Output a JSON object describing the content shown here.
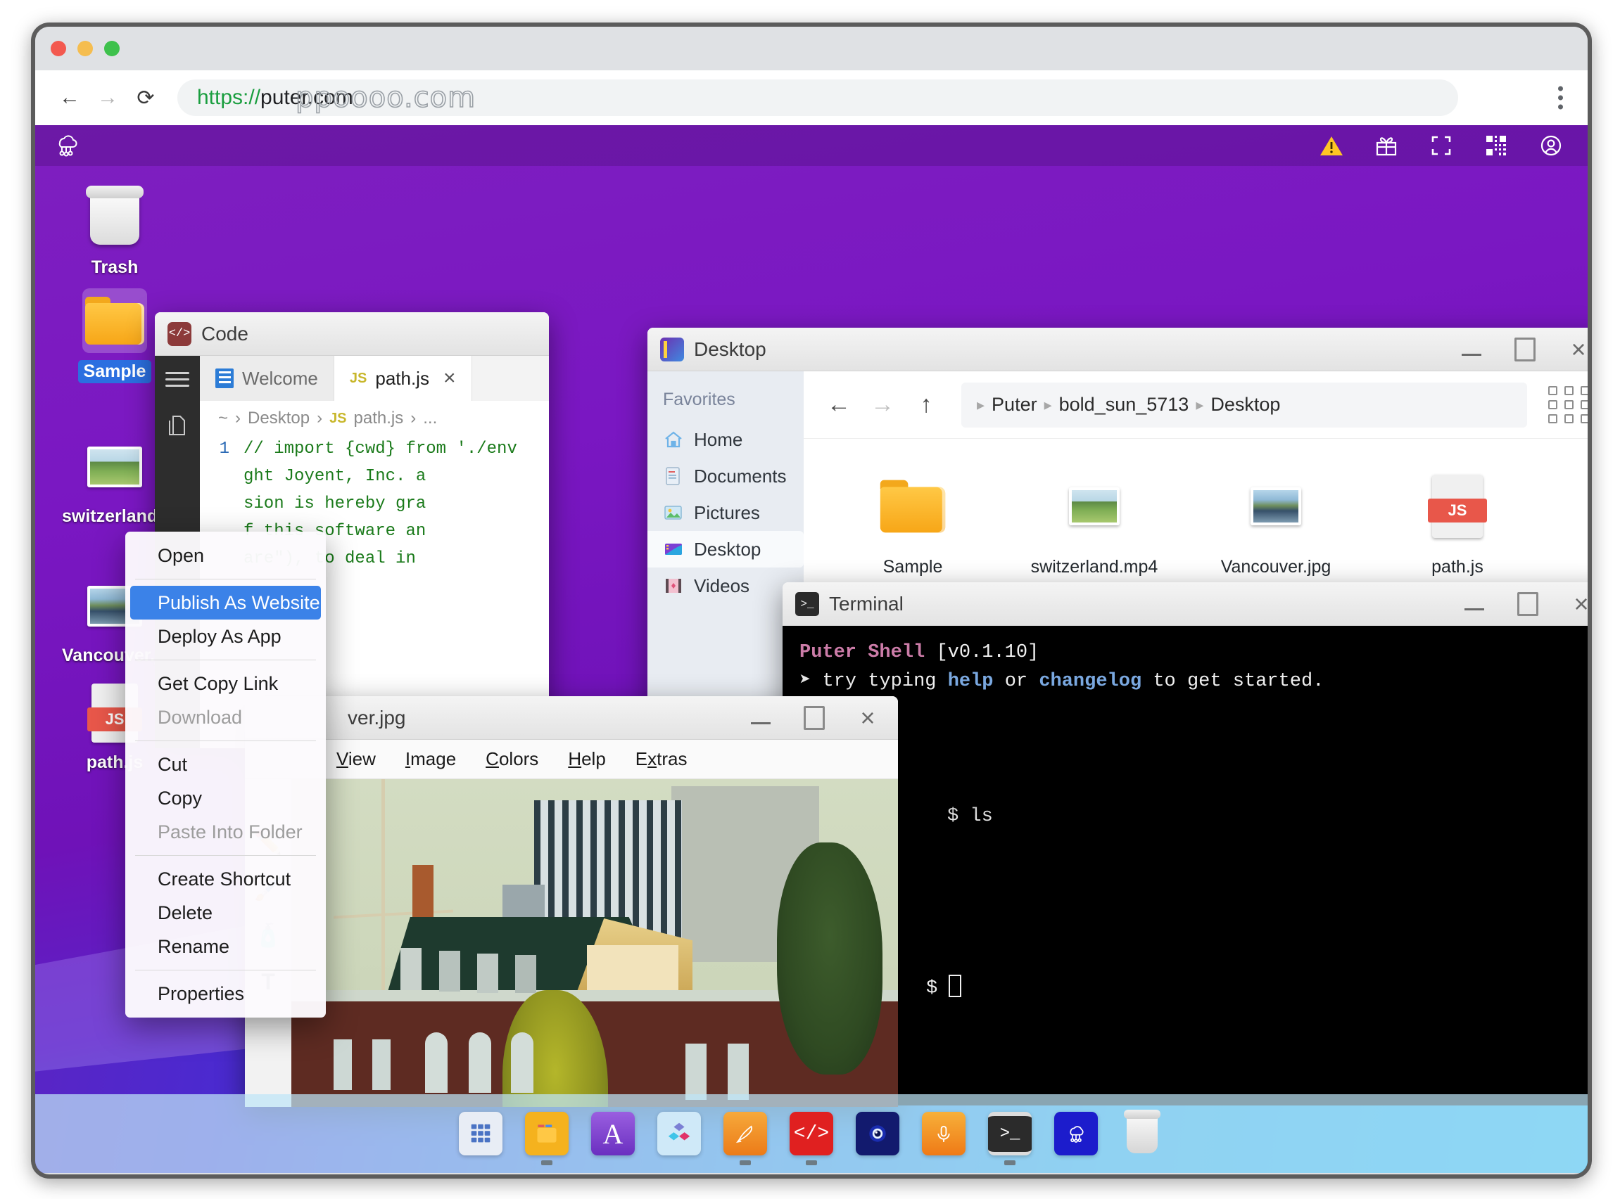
{
  "browser": {
    "url_scheme": "https://",
    "url_rest": "puter.com",
    "watermark": "ppoooo.com",
    "back_icon": "back-arrow-icon",
    "forward_icon": "forward-arrow-icon",
    "reload_icon": "reload-icon",
    "menu_icon": "kebab-menu-icon"
  },
  "topbar": {
    "logo": "puter-cloud-logo",
    "icons": [
      "warning-icon",
      "gift-icon",
      "fullscreen-icon",
      "qr-code-icon",
      "user-account-icon"
    ]
  },
  "desktop_icons": [
    {
      "label": "Trash",
      "icon": "trash-icon",
      "selected": false
    },
    {
      "label": "Sample",
      "icon": "folder-icon",
      "selected": true
    },
    {
      "label": "switzerland.mp4",
      "icon": "video-thumbnail",
      "selected": false
    },
    {
      "label": "Vancouver.jpg",
      "icon": "image-thumbnail",
      "selected": false
    },
    {
      "label": "path.js",
      "icon": "js-file-icon",
      "selected": false
    }
  ],
  "code_window": {
    "title": "Code",
    "tabs": [
      {
        "label": "Welcome",
        "icon": "welcome-icon",
        "active": false
      },
      {
        "label": "path.js",
        "icon": "js-icon",
        "active": true,
        "close": "×"
      }
    ],
    "breadcrumb": [
      "~",
      "Desktop",
      "path.js",
      "..."
    ],
    "js_tag": "JS",
    "lines": [
      {
        "n": "1",
        "text": "// import {cwd} from './env"
      },
      {
        "n": "",
        "text": ""
      },
      {
        "n": "",
        "text": "ght Joyent, Inc. a"
      },
      {
        "n": "",
        "text": ""
      },
      {
        "n": "",
        "text": "sion is hereby gra"
      },
      {
        "n": "",
        "text": "f this software an"
      },
      {
        "n": "",
        "text": "are\"), to deal in"
      }
    ]
  },
  "explorer_window": {
    "title": "Desktop",
    "sidebar_header": "Favorites",
    "sidebar_items": [
      {
        "label": "Home",
        "icon": "home-icon",
        "active": false
      },
      {
        "label": "Documents",
        "icon": "documents-icon",
        "active": false
      },
      {
        "label": "Pictures",
        "icon": "pictures-icon",
        "active": false
      },
      {
        "label": "Desktop",
        "icon": "desktop-icon",
        "active": true
      },
      {
        "label": "Videos",
        "icon": "videos-icon",
        "active": false
      }
    ],
    "breadcrumb": [
      "Puter",
      "bold_sun_5713",
      "Desktop"
    ],
    "nav": {
      "back": "back-arrow-icon",
      "forward": "forward-arrow-icon",
      "up": "up-arrow-icon"
    },
    "view_toggle": "grid-view-icon",
    "files": [
      {
        "label": "Sample",
        "icon": "folder-icon"
      },
      {
        "label": "switzerland.mp4",
        "icon": "video-thumbnail"
      },
      {
        "label": "Vancouver.jpg",
        "icon": "image-thumbnail"
      },
      {
        "label": "path.js",
        "icon": "js-file-icon"
      }
    ]
  },
  "terminal_window": {
    "title": "Terminal",
    "line1_app": "Puter Shell",
    "line1_version": "[v0.1.10]",
    "prompt_glyph": "➤",
    "line2_pre": "try typing ",
    "line2_cmd1": "help",
    "line2_mid": " or ",
    "line2_cmd2": "changelog",
    "line2_post": " to get started.",
    "cmd_prompt": "$",
    "cmd_text": "ls",
    "cursor_prompt": "$"
  },
  "paint_window": {
    "title": "ver.jpg",
    "menu": [
      {
        "label": "View",
        "mnemonic": "V"
      },
      {
        "label": "Image",
        "mnemonic": "I"
      },
      {
        "label": "Colors",
        "mnemonic": "C"
      },
      {
        "label": "Help",
        "mnemonic": "H"
      },
      {
        "label": "Extras",
        "mnemonic": "x"
      }
    ],
    "tools": [
      {
        "name": "pencil-tool",
        "glyph": "✏️"
      },
      {
        "name": "paintbrush-tool",
        "glyph": "🖌️"
      },
      {
        "name": "spray-can-tool",
        "glyph": "🧴"
      },
      {
        "name": "text-tool",
        "glyph": "T"
      }
    ]
  },
  "context_menu": {
    "items": [
      {
        "label": "Open",
        "state": "normal"
      },
      {
        "sep": true
      },
      {
        "label": "Publish As Website",
        "state": "highlight"
      },
      {
        "label": "Deploy As App",
        "state": "normal"
      },
      {
        "sep": true
      },
      {
        "label": "Get Copy Link",
        "state": "normal"
      },
      {
        "label": "Download",
        "state": "disabled"
      },
      {
        "sep": true
      },
      {
        "label": "Cut",
        "state": "normal"
      },
      {
        "label": "Copy",
        "state": "normal"
      },
      {
        "label": "Paste Into Folder",
        "state": "disabled"
      },
      {
        "sep": true
      },
      {
        "label": "Create Shortcut",
        "state": "normal"
      },
      {
        "label": "Delete",
        "state": "normal"
      },
      {
        "label": "Rename",
        "state": "normal"
      },
      {
        "sep": true
      },
      {
        "label": "Properties",
        "state": "normal"
      }
    ]
  },
  "window_controls": {
    "minimize": "minimize-icon",
    "maximize": "maximize-icon",
    "close": "×"
  },
  "dock": {
    "items": [
      {
        "name": "app-launcher",
        "glyph": "∷",
        "color": "#e8edf5",
        "running": false
      },
      {
        "name": "file-explorer",
        "glyph": "",
        "color": "#f5b21e",
        "running": true
      },
      {
        "name": "text-editor",
        "glyph": "A",
        "color": "#7b3fd4",
        "running": false
      },
      {
        "name": "blocks-app",
        "glyph": "",
        "color": "#bee4f6",
        "running": false
      },
      {
        "name": "paint-app",
        "glyph": "🖌",
        "color": "#f08a23",
        "running": true
      },
      {
        "name": "code-app",
        "glyph": "</>",
        "color": "#e02020",
        "running": true
      },
      {
        "name": "viewer-app",
        "glyph": "◉",
        "color": "#121a6e",
        "running": false
      },
      {
        "name": "recorder-app",
        "glyph": "🎙",
        "color": "#f0901e",
        "running": false
      },
      {
        "name": "terminal-app",
        "glyph": ">_",
        "color": "#2b2b2b",
        "running": true
      },
      {
        "name": "puter-app",
        "glyph": "",
        "color": "#1c1ccc",
        "running": false
      },
      {
        "name": "trash-dock",
        "glyph": "",
        "color": "#e6e6e6",
        "running": false
      }
    ]
  },
  "colors": {
    "accent_blue": "#3b82e8",
    "wallpaper_purple": "#7e1fc0",
    "wallpaper_cyan": "#12b4ef",
    "terminal_bg": "#000000",
    "js_red": "#e8574a",
    "folder_yellow": "#f7a617"
  }
}
